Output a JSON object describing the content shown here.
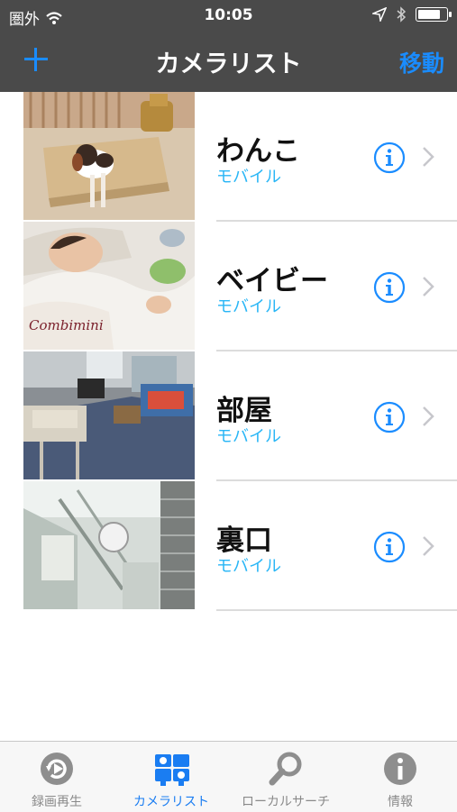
{
  "status_bar": {
    "carrier": "圏外",
    "time": "10:05"
  },
  "nav": {
    "title": "カメラリスト",
    "move_label": "移動",
    "add_icon": "plus-icon"
  },
  "cameras": [
    {
      "name": "わんこ",
      "type": "モバイル"
    },
    {
      "name": "ベイビー",
      "type": "モバイル"
    },
    {
      "name": "部屋",
      "type": "モバイル"
    },
    {
      "name": "裏口",
      "type": "モバイル"
    }
  ],
  "tabs": [
    {
      "label": "録画再生",
      "icon": "playback-icon",
      "active": false
    },
    {
      "label": "カメラリスト",
      "icon": "camera-list-icon",
      "active": true
    },
    {
      "label": "ローカルサーチ",
      "icon": "search-icon",
      "active": false
    },
    {
      "label": "情報",
      "icon": "info-icon",
      "active": false
    }
  ],
  "colors": {
    "accent": "#1a8cff",
    "subtitle": "#29b6f6",
    "nav_bg": "#4a4a4a"
  }
}
